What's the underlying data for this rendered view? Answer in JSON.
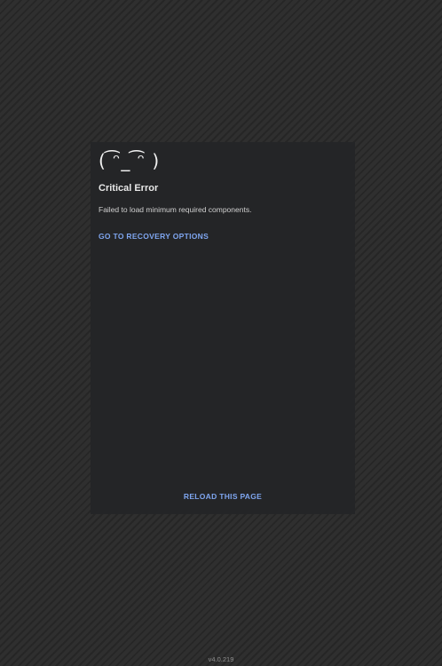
{
  "error_card": {
    "face": "( ͡ᵔ_ ͡ᵔ )",
    "title": "Critical Error",
    "message": "Failed to load minimum required components.",
    "recovery_link": "GO TO RECOVERY OPTIONS",
    "reload_link": "RELOAD THIS PAGE"
  },
  "footer": {
    "version": "v4.0.219"
  },
  "colors": {
    "background": "#2e2e2e",
    "card": "#242527",
    "link": "#7fa6f0"
  }
}
